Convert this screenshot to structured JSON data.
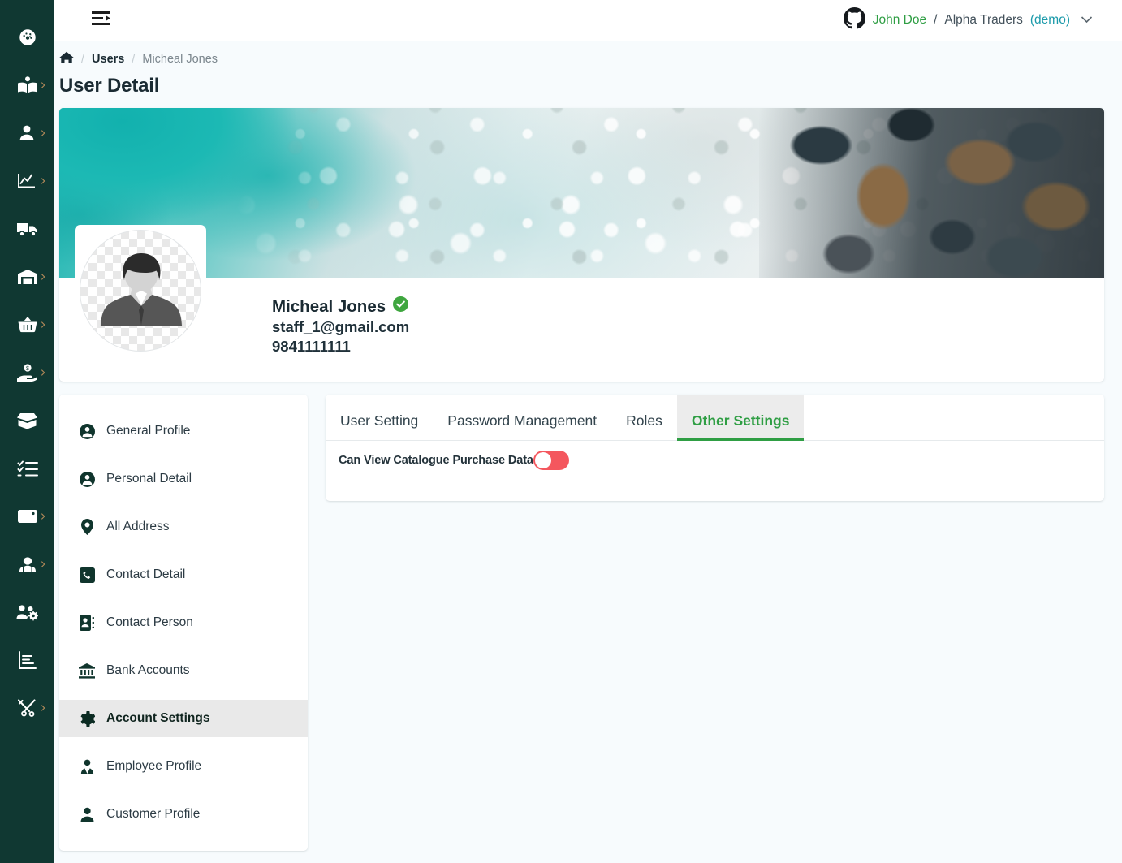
{
  "rail": {
    "items": [
      {
        "icon": "dashboard-icon",
        "expandable": false
      },
      {
        "icon": "catalogue-book-icon",
        "expandable": true
      },
      {
        "icon": "user-icon",
        "expandable": true
      },
      {
        "icon": "sales-chart-icon",
        "expandable": true
      },
      {
        "icon": "delivery-truck-icon",
        "expandable": false
      },
      {
        "icon": "warehouse-icon",
        "expandable": true
      },
      {
        "icon": "shopping-basket-icon",
        "expandable": true
      },
      {
        "icon": "hand-money-icon",
        "expandable": true
      },
      {
        "icon": "open-box-icon",
        "expandable": false
      },
      {
        "icon": "checklist-icon",
        "expandable": false
      },
      {
        "icon": "wallet-icon",
        "expandable": true
      },
      {
        "icon": "team-icon",
        "expandable": true
      },
      {
        "icon": "users-cog-icon",
        "expandable": false
      },
      {
        "icon": "report-bar-icon",
        "expandable": false
      },
      {
        "icon": "tools-icon",
        "expandable": true
      }
    ]
  },
  "topbar": {
    "fold_icon": "menu-fold-icon",
    "account": {
      "logo_icon": "github-icon",
      "user_name": "John Doe",
      "separator": "/",
      "org_name": "Alpha Traders",
      "org_mode": "(demo)",
      "chevron_icon": "chevron-down-icon"
    }
  },
  "breadcrumb": {
    "home_icon": "home-icon",
    "sep": "/",
    "items": [
      "Users",
      "Micheal Jones"
    ]
  },
  "page": {
    "title": "User Detail"
  },
  "profile": {
    "banner_alt": "ocean-surf-banner",
    "avatar_alt": "default-user-avatar",
    "name": "Micheal Jones",
    "verified_icon": "verified-check-icon",
    "email": "staff_1@gmail.com",
    "phone": "9841111111"
  },
  "side_menu": {
    "items": [
      {
        "label": "General Profile",
        "icon": "user-circle-icon",
        "active": false
      },
      {
        "label": "Personal Detail",
        "icon": "user-circle-icon",
        "active": false
      },
      {
        "label": "All Address",
        "icon": "map-pin-icon",
        "active": false
      },
      {
        "label": "Contact Detail",
        "icon": "phone-square-icon",
        "active": false
      },
      {
        "label": "Contact Person",
        "icon": "address-book-icon",
        "active": false
      },
      {
        "label": "Bank Accounts",
        "icon": "bank-icon",
        "active": false
      },
      {
        "label": "Account Settings",
        "icon": "gear-icon",
        "active": true
      },
      {
        "label": "Employee Profile",
        "icon": "employee-tie-icon",
        "active": false
      },
      {
        "label": "Customer Profile",
        "icon": "user-solid-icon",
        "active": false
      }
    ]
  },
  "tabs": {
    "items": [
      {
        "label": "User Setting",
        "active": false
      },
      {
        "label": "Password Management",
        "active": false
      },
      {
        "label": "Roles",
        "active": false
      },
      {
        "label": "Other Settings",
        "active": true
      }
    ],
    "active_color": "#2f9e44"
  },
  "other_settings": {
    "rows": [
      {
        "label": "Can View Catalogue Purchase Data",
        "enabled": false,
        "toggle_color": "#f4575e"
      }
    ]
  },
  "colors": {
    "rail_bg": "#103832",
    "page_bg": "#f7fbfd",
    "accent_green": "#2f9e44",
    "demo_teal": "#1b9aaa",
    "toggle_red": "#f4575e",
    "menu_active_bg": "#e9e9e9",
    "tab_active_bg": "#ececec"
  }
}
